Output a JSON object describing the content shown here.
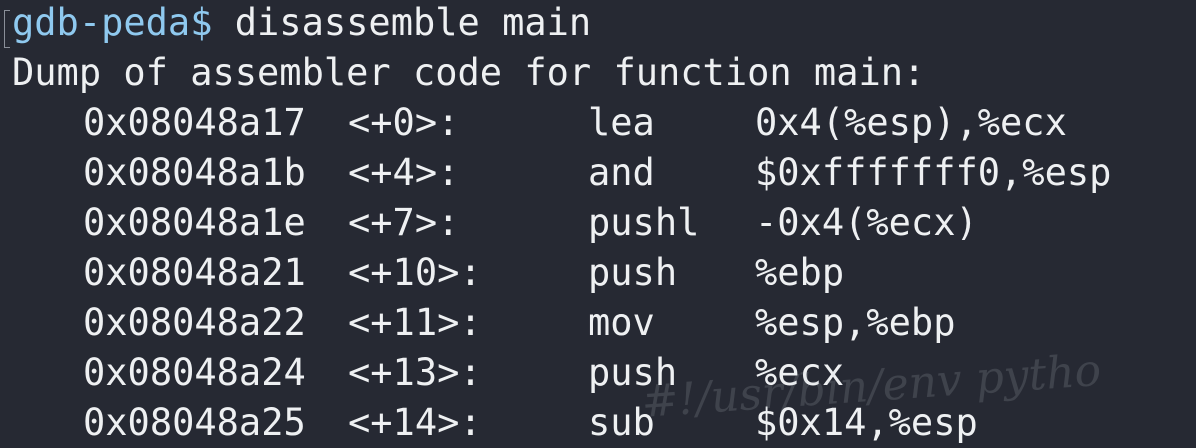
{
  "terminal": {
    "prompt": "gdb-peda$",
    "command": " disassemble main",
    "header": "Dump of assembler code for function main:",
    "rows": [
      {
        "address": "0x08048a17",
        "offset": "<+0>:",
        "mnemonic": "lea",
        "operands": "0x4(%esp),%ecx"
      },
      {
        "address": "0x08048a1b",
        "offset": "<+4>:",
        "mnemonic": "and",
        "operands": "$0xfffffff0,%esp"
      },
      {
        "address": "0x08048a1e",
        "offset": "<+7>:",
        "mnemonic": "pushl",
        "operands": "-0x4(%ecx)"
      },
      {
        "address": "0x08048a21",
        "offset": "<+10>:",
        "mnemonic": "push",
        "operands": "%ebp"
      },
      {
        "address": "0x08048a22",
        "offset": "<+11>:",
        "mnemonic": "mov",
        "operands": "%esp,%ebp"
      },
      {
        "address": "0x08048a24",
        "offset": "<+13>:",
        "mnemonic": "push",
        "operands": "%ecx"
      },
      {
        "address": "0x08048a25",
        "offset": "<+14>:",
        "mnemonic": "sub",
        "operands": "$0x14,%esp"
      }
    ],
    "watermark": "#!/usr/bin/env pytho"
  },
  "colors": {
    "background": "#262933",
    "text": "#eef0f2",
    "prompt": "#8fc9ef"
  }
}
